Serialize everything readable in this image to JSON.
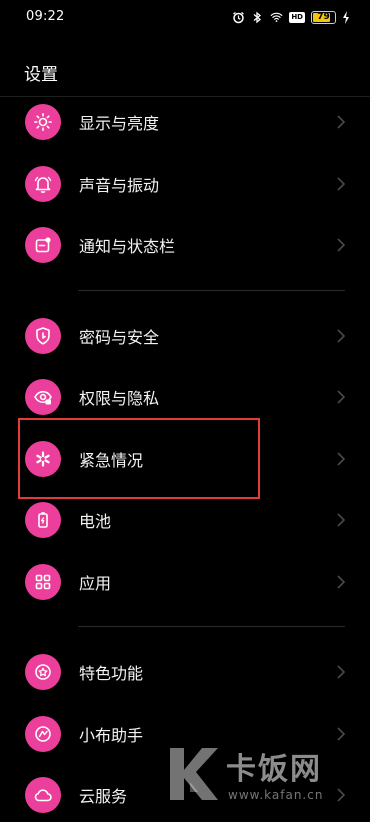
{
  "status_bar": {
    "time": "09:22",
    "battery": "79",
    "battery_level": 0.79,
    "network_badge": "HD",
    "icons": [
      "alarm-icon",
      "bluetooth-icon",
      "wifi-icon",
      "hd-badge-icon",
      "battery-icon",
      "charging-icon"
    ]
  },
  "header": {
    "title": "设置"
  },
  "settings": {
    "items": [
      {
        "label": "显示与亮度",
        "icon": "sun-icon"
      },
      {
        "label": "声音与振动",
        "icon": "bell-icon"
      },
      {
        "label": "通知与状态栏",
        "icon": "notification-icon"
      },
      {
        "label": "密码与安全",
        "icon": "shield-icon"
      },
      {
        "label": "权限与隐私",
        "icon": "eye-lock-icon"
      },
      {
        "label": "紧急情况",
        "icon": "asterisk-icon"
      },
      {
        "label": "电池",
        "icon": "battery-icon"
      },
      {
        "label": "应用",
        "icon": "apps-grid-icon"
      },
      {
        "label": "特色功能",
        "icon": "star-badge-icon"
      },
      {
        "label": "小布助手",
        "icon": "assistant-icon"
      },
      {
        "label": "云服务",
        "icon": "cloud-icon"
      }
    ]
  },
  "colors": {
    "accent": "#ec3f9b",
    "highlight": "#e23b3b",
    "background": "#000000"
  },
  "watermark": {
    "title": "卡饭网",
    "url": "www.kafan.cn"
  }
}
